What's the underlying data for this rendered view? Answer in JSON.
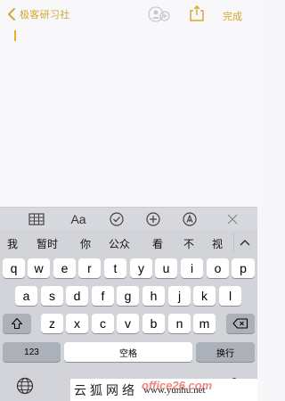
{
  "nav": {
    "back_label": "极客研习社",
    "done_label": "完成"
  },
  "colors": {
    "accent": "#d4a72c",
    "keyboard_bg": "#d2d4da",
    "key_bg": "#ffffff",
    "key_dark_bg": "#acb0b8"
  },
  "format_toolbar": {
    "items": [
      "table-icon",
      "Aa",
      "checklist-icon",
      "plus-icon",
      "markup-icon",
      "close-icon"
    ],
    "text_style_label": "Aa"
  },
  "candidates": [
    "我",
    "暂时",
    "你",
    "公众",
    "看",
    "不",
    "视"
  ],
  "keyboard": {
    "row1": [
      "q",
      "w",
      "e",
      "r",
      "t",
      "y",
      "u",
      "i",
      "o",
      "p"
    ],
    "row2": [
      "a",
      "s",
      "d",
      "f",
      "g",
      "h",
      "j",
      "k",
      "l"
    ],
    "row3": [
      "z",
      "x",
      "c",
      "v",
      "b",
      "n",
      "m"
    ],
    "numbers_label": "123",
    "space_label": "空格",
    "return_label": "换行"
  },
  "watermark": {
    "text_cn": "云狐网络",
    "url": "www.yunhu.net",
    "brand": "office26.com"
  }
}
